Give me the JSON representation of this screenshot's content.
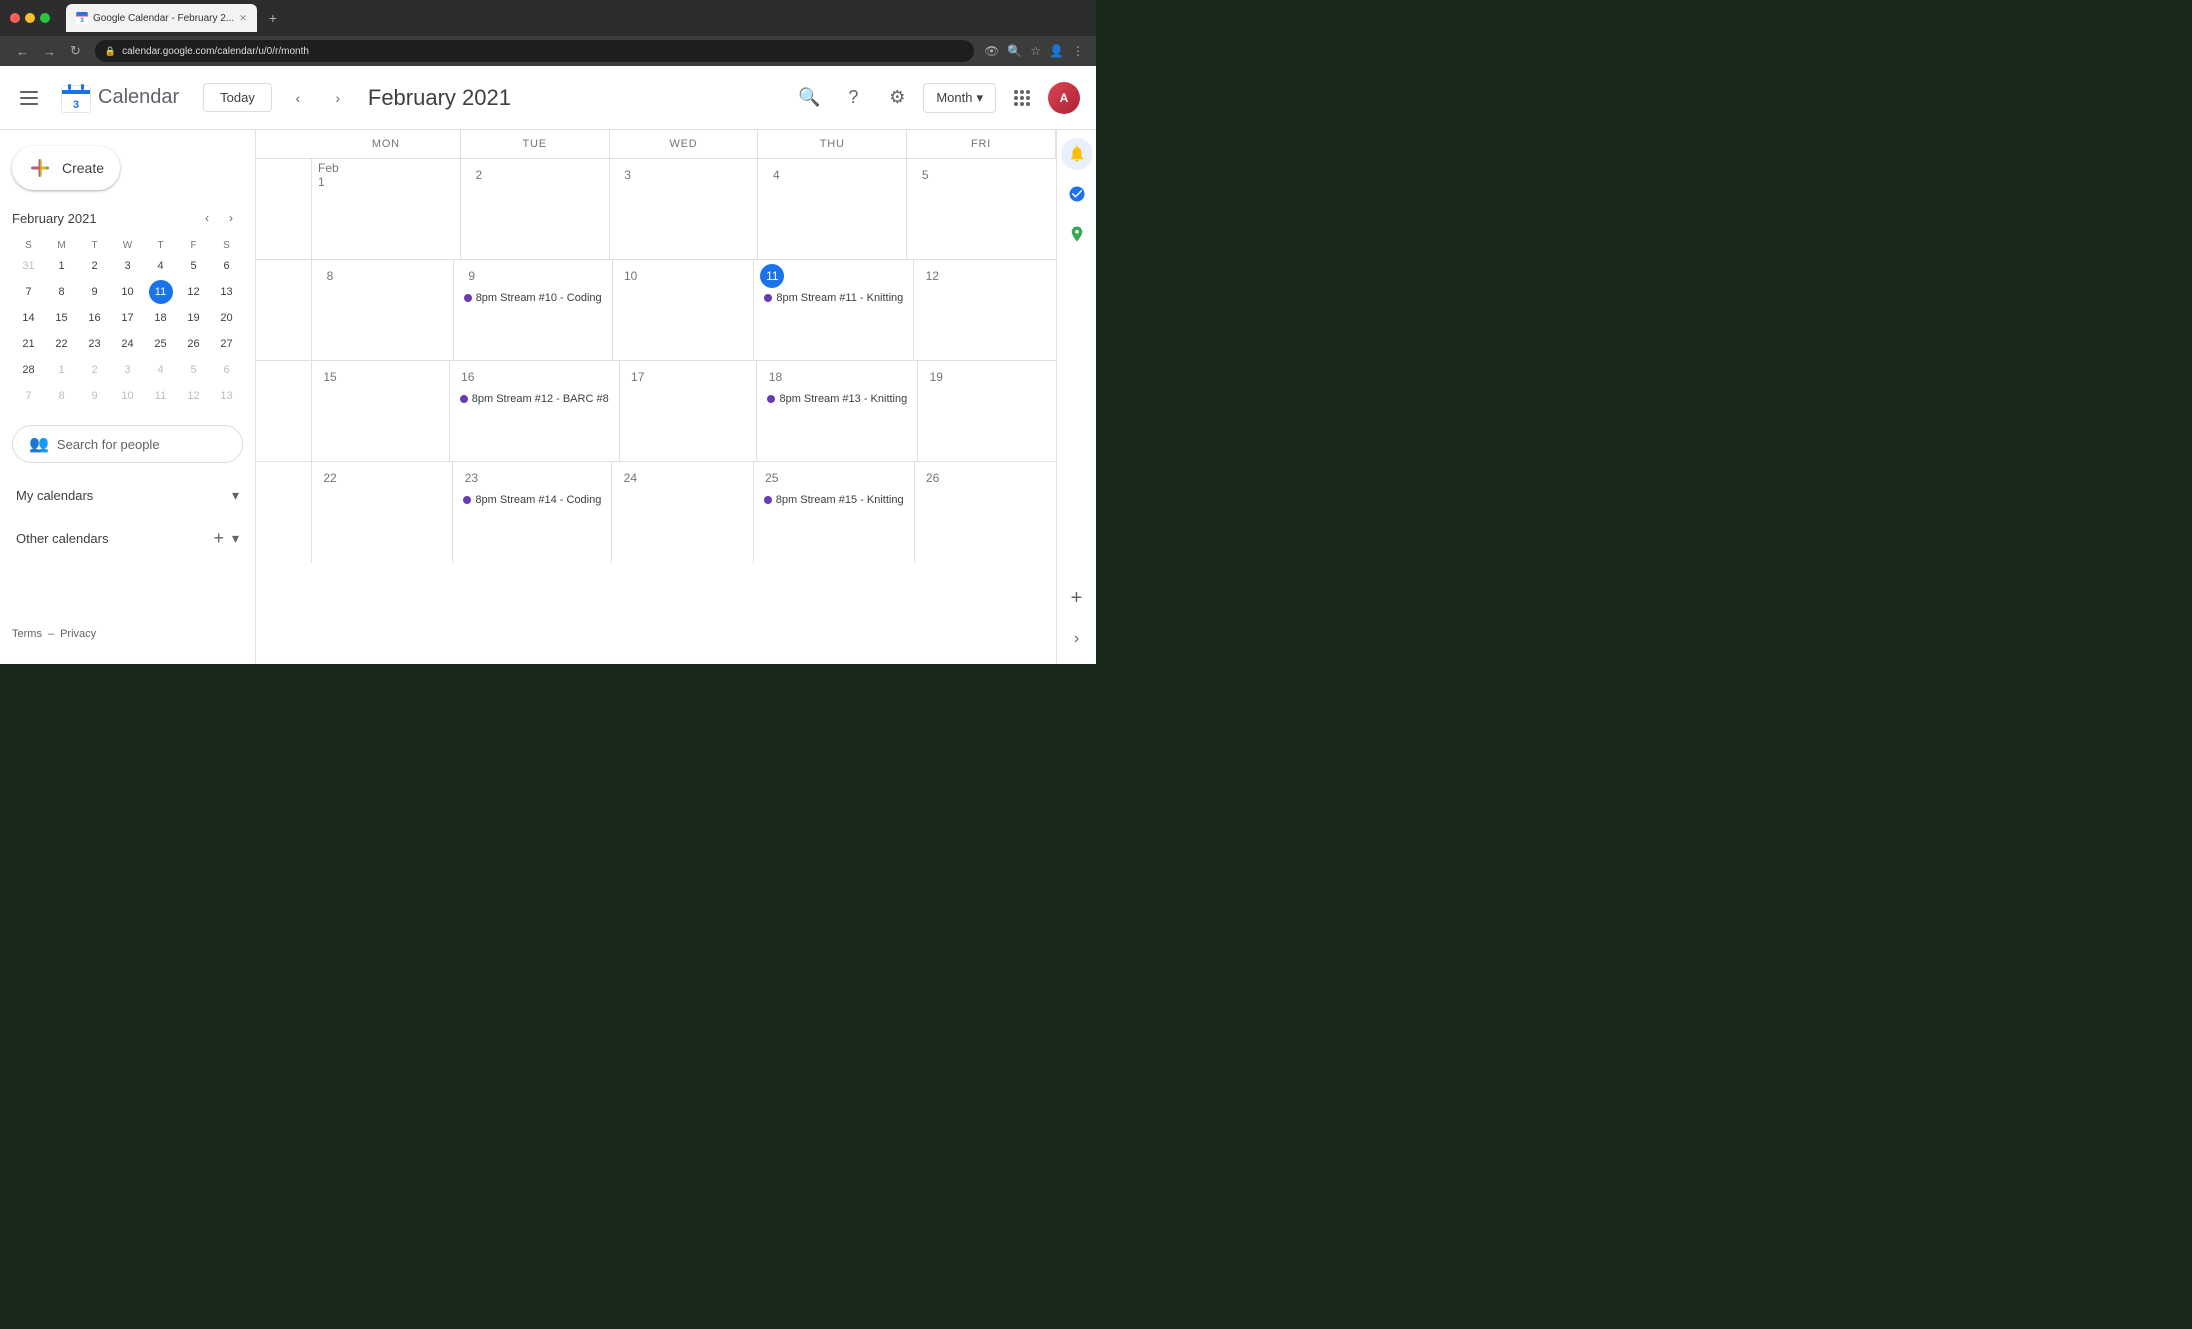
{
  "browser": {
    "url": "calendar.google.com/calendar/u/0/r/month",
    "tab_title": "Google Calendar - February 2...",
    "new_tab_label": "+"
  },
  "header": {
    "title": "February 2021",
    "today_label": "Today",
    "view_label": "Month",
    "logo_text": "Calendar",
    "hamburger_label": "Main menu"
  },
  "mini_calendar": {
    "title": "February 2021",
    "day_headers": [
      "S",
      "M",
      "T",
      "W",
      "T",
      "F",
      "S"
    ],
    "weeks": [
      [
        "31",
        "1",
        "2",
        "3",
        "4",
        "5",
        "6"
      ],
      [
        "7",
        "8",
        "9",
        "10",
        "11",
        "12",
        "13"
      ],
      [
        "14",
        "15",
        "16",
        "17",
        "18",
        "19",
        "20"
      ],
      [
        "21",
        "22",
        "23",
        "24",
        "25",
        "26",
        "27"
      ],
      [
        "28",
        "1",
        "2",
        "3",
        "4",
        "5",
        "6"
      ],
      [
        "7",
        "8",
        "9",
        "10",
        "11",
        "12",
        "13"
      ]
    ],
    "today_date": "11",
    "other_month_start": [
      "31"
    ],
    "other_month_end": [
      "1",
      "2",
      "3",
      "4",
      "5",
      "6",
      "7",
      "8",
      "9",
      "10",
      "11",
      "12",
      "13"
    ]
  },
  "people_search": {
    "placeholder": "Search for people"
  },
  "my_calendars": {
    "label": "My calendars",
    "expand_label": "▾"
  },
  "other_calendars": {
    "label": "Other calendars",
    "expand_label": "▾",
    "add_label": "+"
  },
  "sidebar_footer": {
    "terms": "Terms",
    "dash": "–",
    "privacy": "Privacy"
  },
  "calendar_grid": {
    "day_headers": [
      "MON",
      "TUE",
      "WED",
      "THU",
      "FRI"
    ],
    "weeks": [
      {
        "days": [
          {
            "num": "Feb 1",
            "is_first": true,
            "events": []
          },
          {
            "num": "2",
            "events": []
          },
          {
            "num": "3",
            "events": []
          },
          {
            "num": "4",
            "events": []
          },
          {
            "num": "5",
            "events": []
          }
        ]
      },
      {
        "days": [
          {
            "num": "8",
            "events": []
          },
          {
            "num": "9",
            "events": [
              {
                "dot_color": "#673ab7",
                "text": "8pm Stream #10 - Coding"
              }
            ]
          },
          {
            "num": "10",
            "events": []
          },
          {
            "num": "11",
            "is_today": true,
            "events": [
              {
                "dot_color": "#673ab7",
                "text": "8pm Stream #11 - Knitting"
              }
            ]
          },
          {
            "num": "12",
            "events": []
          }
        ]
      },
      {
        "days": [
          {
            "num": "15",
            "events": []
          },
          {
            "num": "16",
            "events": [
              {
                "dot_color": "#673ab7",
                "text": "8pm Stream #12 - BARC #8"
              }
            ]
          },
          {
            "num": "17",
            "events": []
          },
          {
            "num": "18",
            "events": [
              {
                "dot_color": "#673ab7",
                "text": "8pm Stream #13 - Knitting"
              }
            ]
          },
          {
            "num": "19",
            "events": []
          }
        ]
      },
      {
        "days": [
          {
            "num": "22",
            "events": []
          },
          {
            "num": "23",
            "events": [
              {
                "dot_color": "#673ab7",
                "text": "8pm Stream #14 - Coding"
              }
            ]
          },
          {
            "num": "24",
            "events": []
          },
          {
            "num": "25",
            "events": [
              {
                "dot_color": "#673ab7",
                "text": "8pm Stream #15 - Knitting"
              }
            ]
          },
          {
            "num": "26",
            "events": []
          }
        ]
      }
    ]
  },
  "colors": {
    "accent_blue": "#1a73e8",
    "event_purple": "#673ab7",
    "today_bg": "#1a73e8"
  }
}
